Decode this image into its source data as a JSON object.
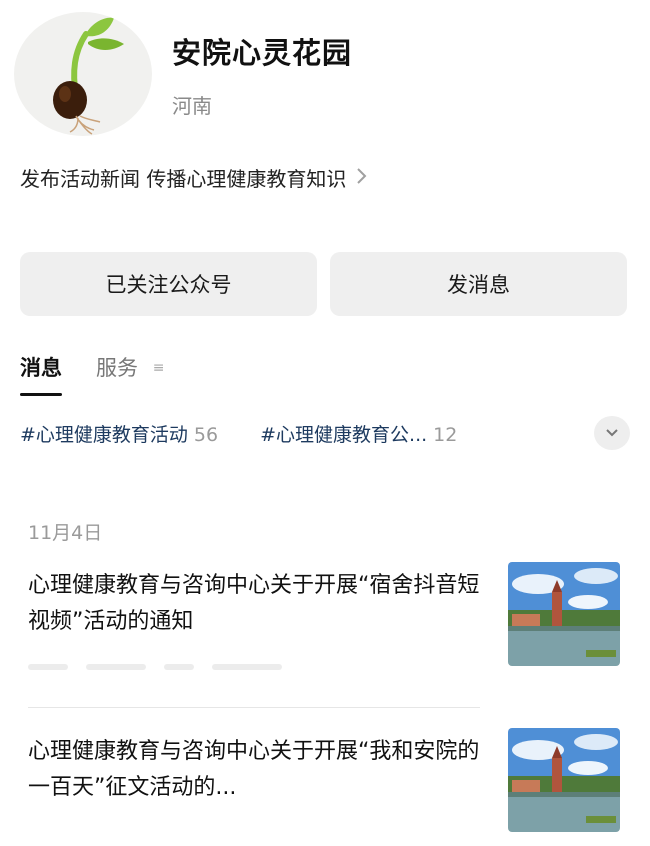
{
  "account": {
    "name": "安院心灵花园",
    "region": "河南",
    "intro": "发布活动新闻 传播心理健康教育知识",
    "avatar_icon": "sprout-icon"
  },
  "actions": {
    "follow_label": "已关注公众号",
    "message_label": "发消息"
  },
  "tabs": [
    {
      "label": "消息",
      "active": true
    },
    {
      "label": "服务",
      "active": false
    }
  ],
  "topic_tags": [
    {
      "label": "#心理健康教育活动",
      "count": "56"
    },
    {
      "label": "#心理健康教育公...",
      "count": "12"
    }
  ],
  "feed": {
    "date": "11月4日",
    "articles": [
      {
        "title": "心理健康教育与咨询中心关于开展“宿舍抖音短视频”活动的通知",
        "thumbnail_icon": "campus-clocktower-image"
      },
      {
        "title": "心理健康教育与咨询中心关于开展“我和安院的一百天”征文活动的...",
        "thumbnail_icon": "campus-clocktower-image"
      }
    ]
  },
  "colors": {
    "tag_text": "#1d3a5f",
    "button_bg": "#efefef",
    "muted_text": "#9a9a9a"
  }
}
